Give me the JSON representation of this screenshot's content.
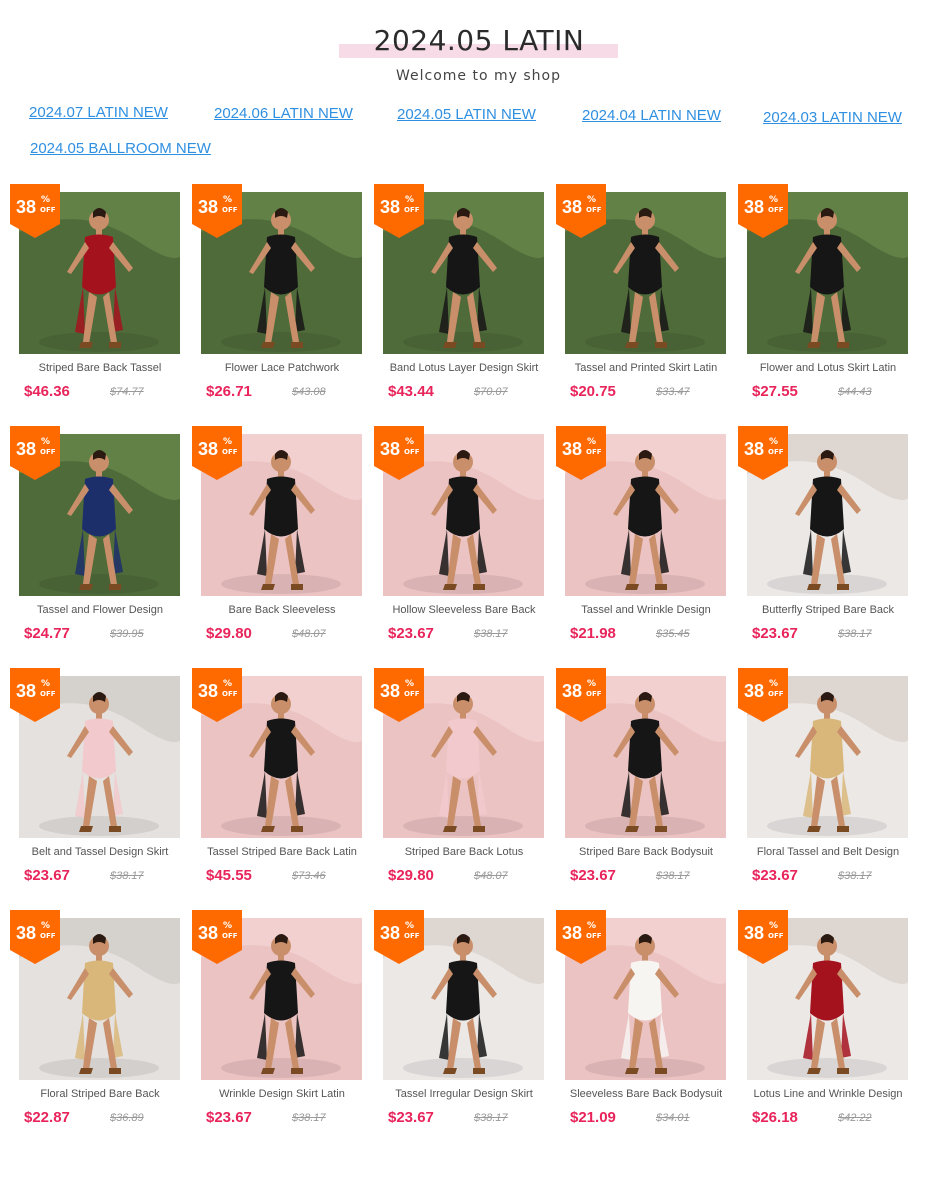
{
  "page": {
    "title": "2024.05 LATIN",
    "subtitle": "Welcome to my shop"
  },
  "nav": {
    "links": [
      "2024.07 LATIN NEW",
      "2024.06 LATIN NEW",
      "2024.05 LATIN NEW",
      "2024.04 LATIN NEW",
      "2024.03 LATIN NEW",
      "2024.05 BALLROOM NEW"
    ]
  },
  "colors": {
    "link": "#2f8fe0",
    "price": "#e8245b",
    "badge": "#ff6a00",
    "title_highlight": "#f7dbe6"
  },
  "badge": {
    "num": "38",
    "pct": "%",
    "off": "OFF"
  },
  "products": [
    {
      "name": "Striped Bare Back Tassel",
      "price": "$46.36",
      "orig": "$74.77",
      "bg": "green",
      "outfit": "red"
    },
    {
      "name": "Flower Lace Patchwork",
      "price": "$26.71",
      "orig": "$43.08",
      "bg": "green",
      "outfit": "black"
    },
    {
      "name": "Band Lotus Layer Design Skirt",
      "price": "$43.44",
      "orig": "$70.07",
      "bg": "green",
      "outfit": "black"
    },
    {
      "name": "Tassel and Printed Skirt Latin",
      "price": "$20.75",
      "orig": "$33.47",
      "bg": "green",
      "outfit": "black"
    },
    {
      "name": "Flower and Lotus Skirt Latin",
      "price": "$27.55",
      "orig": "$44.43",
      "bg": "green",
      "outfit": "black"
    },
    {
      "name": "Tassel and Flower Design",
      "price": "$24.77",
      "orig": "$39.95",
      "bg": "green",
      "outfit": "navy"
    },
    {
      "name": "Bare Back Sleeveless",
      "price": "$29.80",
      "orig": "$48.07",
      "bg": "pink",
      "outfit": "black"
    },
    {
      "name": "Hollow Sleeveless Bare Back",
      "price": "$23.67",
      "orig": "$38.17",
      "bg": "pink",
      "outfit": "black"
    },
    {
      "name": "Tassel and Wrinkle Design",
      "price": "$21.98",
      "orig": "$35.45",
      "bg": "pink",
      "outfit": "black"
    },
    {
      "name": "Butterfly Striped Bare Back",
      "price": "$23.67",
      "orig": "$38.17",
      "bg": "white",
      "outfit": "black"
    },
    {
      "name": "Belt and Tassel Design Skirt",
      "price": "$23.67",
      "orig": "$38.17",
      "bg": "brick",
      "outfit": "pink"
    },
    {
      "name": "Tassel Striped Bare Back Latin",
      "price": "$45.55",
      "orig": "$73.46",
      "bg": "pink",
      "outfit": "black"
    },
    {
      "name": "Striped Bare Back Lotus",
      "price": "$29.80",
      "orig": "$48.07",
      "bg": "pink",
      "outfit": "pink"
    },
    {
      "name": "Striped Bare Back Bodysuit",
      "price": "$23.67",
      "orig": "$38.17",
      "bg": "pink",
      "outfit": "black"
    },
    {
      "name": "Floral Tassel and Belt Design",
      "price": "$23.67",
      "orig": "$38.17",
      "bg": "white",
      "outfit": "floral"
    },
    {
      "name": "Floral Striped Bare Back",
      "price": "$22.87",
      "orig": "$36.89",
      "bg": "brick",
      "outfit": "floral"
    },
    {
      "name": "Wrinkle Design Skirt Latin",
      "price": "$23.67",
      "orig": "$38.17",
      "bg": "pink",
      "outfit": "black"
    },
    {
      "name": "Tassel Irregular Design Skirt",
      "price": "$23.67",
      "orig": "$38.17",
      "bg": "white",
      "outfit": "black"
    },
    {
      "name": "Sleeveless Bare Back Bodysuit",
      "price": "$21.09",
      "orig": "$34.01",
      "bg": "pink",
      "outfit": "white"
    },
    {
      "name": "Lotus Line and Wrinkle Design",
      "price": "$26.18",
      "orig": "$42.22",
      "bg": "white",
      "outfit": "red"
    }
  ]
}
